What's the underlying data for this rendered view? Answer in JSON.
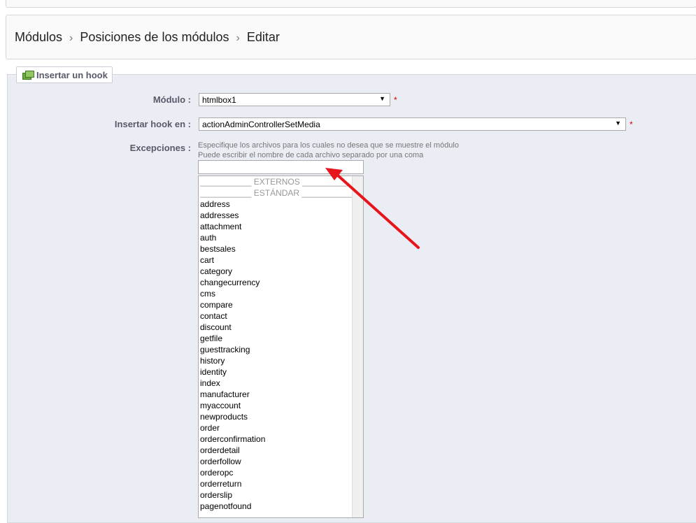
{
  "breadcrumb": {
    "items": [
      "Módulos",
      "Posiciones de los módulos",
      "Editar"
    ],
    "separator": "›"
  },
  "fieldset": {
    "legend": "Insertar un hook",
    "legend_icon": "modules-icon"
  },
  "form": {
    "modulo": {
      "label": "Módulo :",
      "value": "htmlbox1",
      "required_mark": "*"
    },
    "hook": {
      "label": "Insertar hook en :",
      "value": "actionAdminControllerSetMedia",
      "required_mark": "*"
    },
    "excepciones": {
      "label": "Excepciones :",
      "hint_line1": "Especifique los archivos para los cuales no desea que se muestre el módulo",
      "hint_line2": "Puede escribir el nombre de cada archivo separado por una coma",
      "input_value": "",
      "groups": [
        "___________ EXTERNOS ___________",
        "___________ ESTÁNDAR ___________"
      ],
      "options": [
        "address",
        "addresses",
        "attachment",
        "auth",
        "bestsales",
        "cart",
        "category",
        "changecurrency",
        "cms",
        "compare",
        "contact",
        "discount",
        "getfile",
        "guesttracking",
        "history",
        "identity",
        "index",
        "manufacturer",
        "myaccount",
        "newproducts",
        "order",
        "orderconfirmation",
        "orderdetail",
        "orderfollow",
        "orderopc",
        "orderreturn",
        "orderslip",
        "pagenotfound"
      ]
    }
  },
  "colors": {
    "fieldset_bg": "#ebedf4",
    "annotation_arrow": "#e8141b",
    "required": "#cc0000"
  }
}
